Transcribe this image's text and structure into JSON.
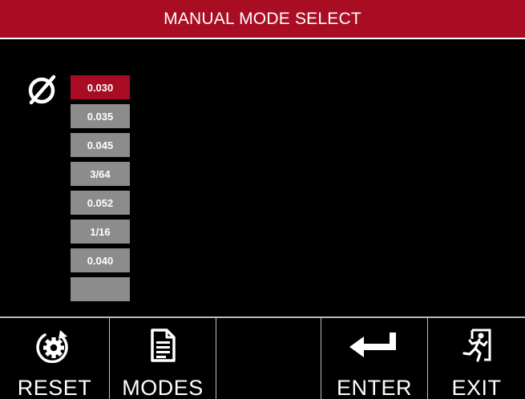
{
  "header": {
    "title": "MANUAL MODE SELECT"
  },
  "diameter_symbol": "diameter-icon",
  "wire_sizes": {
    "selected_index": 0,
    "items": [
      {
        "label": "0.030"
      },
      {
        "label": "0.035"
      },
      {
        "label": "0.045"
      },
      {
        "label": "3/64"
      },
      {
        "label": "0.052"
      },
      {
        "label": "1/16"
      },
      {
        "label": "0.040"
      },
      {
        "label": ""
      }
    ]
  },
  "toolbar": {
    "reset_label": "RESET",
    "modes_label": "MODES",
    "blank_label": "",
    "enter_label": "ENTER",
    "exit_label": "EXIT"
  },
  "colors": {
    "accent": "#a80d23",
    "button": "#8c8c8c",
    "background": "#000000"
  }
}
